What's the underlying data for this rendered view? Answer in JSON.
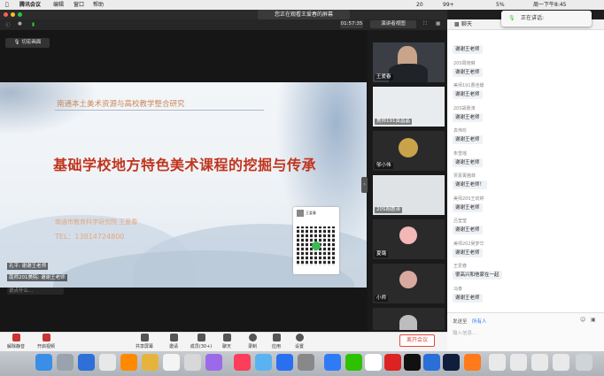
{
  "menubar": {
    "app": "腾讯会议",
    "edit": "编辑",
    "window": "窗口",
    "help": "帮助",
    "battery": "20",
    "wifi": "99+",
    "vol": "5%",
    "clock": "周一下午8:45"
  },
  "meeting": {
    "share_banner": "您正在观看王爱春的屏幕",
    "timer": "01:57:35",
    "view_label": "演讲者视图",
    "chat_tab": "聊天",
    "gallery_label": "切宏画面"
  },
  "speaking": {
    "label": "正在讲话:"
  },
  "slide": {
    "subtitle": "南通本土美术资源与高校教学整合研究",
    "title": "基础学校地方特色美术课程的挖掘与传承",
    "org": "南通市教育科学研究院    王爱春",
    "phone": "TEL：13814724800",
    "qr_caption": "王爱春",
    "danmaku": [
      "孔平: 谢谢王老师",
      "南师201美院: 谢谢王老师",
      "说点什么..."
    ]
  },
  "tiles": [
    {
      "label": "王爱春"
    },
    {
      "label": "美师191黄昌晶"
    },
    {
      "label": "邬小伟"
    },
    {
      "label": "20S胡惠涛"
    },
    {
      "label": "夏璐"
    },
    {
      "label": "小师"
    }
  ],
  "chat": {
    "items": [
      {
        "name": "",
        "msg": "谢谢王老师"
      },
      {
        "name": "20S周晓琳",
        "msg": "谢谢王老师"
      },
      {
        "name": "美师191曹佳媛",
        "msg": "谢谢王老师"
      },
      {
        "name": "20S胡惠涛",
        "msg": "谢谢王老师"
      },
      {
        "name": "袁伟珍",
        "msg": "谢谢王老师"
      },
      {
        "name": "朱雪瑶",
        "msg": "谢谢王老师"
      },
      {
        "name": "贾嘉菁茜菲",
        "msg": "谢谢王老师！"
      },
      {
        "name": "美师20S王劲婷",
        "msg": "谢谢王老师"
      },
      {
        "name": "吕莹莹",
        "msg": "谢谢王老师"
      },
      {
        "name": "美师202吴梦华",
        "msg": "谢谢王老师"
      },
      {
        "name": "王爱春",
        "msg": "很高兴和他家在一起"
      },
      {
        "name": "马泰",
        "msg": "谢谢王老师"
      }
    ],
    "send_to": "发送至",
    "send_target": "所有人",
    "input_placeholder": "输入信息..."
  },
  "toolbar": {
    "mute": "解除静音",
    "video": "开启视频",
    "share": "共享屏幕",
    "invite": "邀请",
    "members": "成员(30+)",
    "chat": "聊天",
    "record": "录制",
    "apps": "应用",
    "settings": "设置",
    "leave": "离开会议"
  },
  "colors": {
    "accent": "#2f7bf6",
    "leave": "#e24a3b",
    "title_red": "#c0341d"
  }
}
